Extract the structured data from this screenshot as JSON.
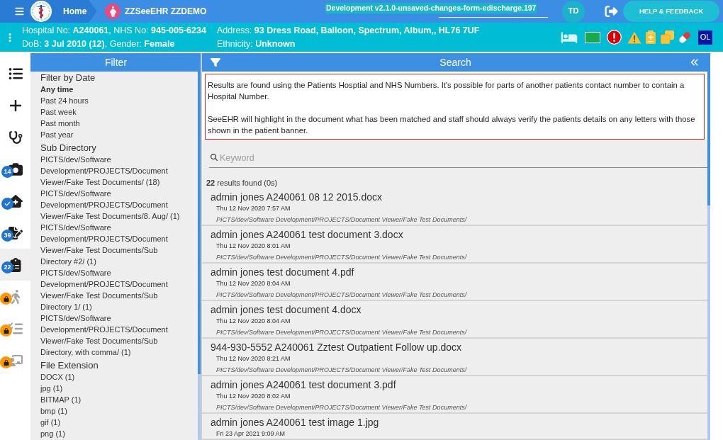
{
  "top_bar": {
    "breadcrumb": "Home",
    "patient_name": "ZZSeeEHR ZZDEMO",
    "version": "Development v2.1.0-unsaved-changes-form-edischarge.197",
    "user_initials": "TD",
    "help_button": "HELP & FEEDBACK"
  },
  "patient_banner": {
    "hospital_line": "Hospital No: **A240061**, NHS No: **945-005-6234**",
    "dob_line": "DoB: **3 Jul 2010 (12)**, Gender: **Female**",
    "address_line": "Address: **93 Dress Road, Balloon, Spectrum, Album,, HL76 7UF**",
    "ethnicity_line": "Ethnicity: **Unknown**",
    "flag_label": "OL"
  },
  "nav": [
    {
      "kind": "list",
      "selected": false,
      "locked": false,
      "verified": false
    },
    {
      "kind": "add",
      "selected": false,
      "locked": false,
      "verified": false
    },
    {
      "kind": "stethoscope",
      "selected": false,
      "locked": false,
      "verified": false
    },
    {
      "kind": "camera",
      "badge": "14",
      "selected": false,
      "locked": false,
      "verified": false
    },
    {
      "kind": "house",
      "selected": false,
      "locked": false,
      "verified": true
    },
    {
      "kind": "signature",
      "badge": "39",
      "selected": false,
      "locked": false,
      "verified": false
    },
    {
      "kind": "clipboard",
      "badge": "22",
      "selected": true,
      "locked": false,
      "verified": false
    },
    {
      "kind": "walker",
      "selected": false,
      "locked": true,
      "verified": false
    },
    {
      "kind": "checklist",
      "selected": false,
      "locked": true,
      "verified": false
    },
    {
      "kind": "presentation",
      "selected": false,
      "locked": true,
      "verified": false
    }
  ],
  "filter": {
    "title": "Filter",
    "sections": [
      {
        "heading": "Filter by Date",
        "options": [
          {
            "label": "Any time",
            "selected": true
          },
          {
            "label": "Past 24 hours",
            "selected": false
          },
          {
            "label": "Past week",
            "selected": false
          },
          {
            "label": "Past month",
            "selected": false
          },
          {
            "label": "Past year",
            "selected": false
          }
        ]
      },
      {
        "heading": "Sub Directory",
        "options": [
          {
            "label": "PICTS/dev/Software Development/PROJECTS/Document Viewer/Fake Test Documents/ (18)"
          },
          {
            "label": "PICTS/dev/Software Development/PROJECTS/Document Viewer/Fake Test Documents/8. Aug/ (1)"
          },
          {
            "label": "PICTS/dev/Software Development/PROJECTS/Document Viewer/Fake Test Documents/Sub Directory #2/ (1)"
          },
          {
            "label": "PICTS/dev/Software Development/PROJECTS/Document Viewer/Fake Test Documents/Sub Directory 1/ (1)"
          },
          {
            "label": "PICTS/dev/Software Development/PROJECTS/Document Viewer/Fake Test Documents/Sub Directory, with comma/ (1)"
          }
        ]
      },
      {
        "heading": "File Extension",
        "options": [
          {
            "label": "DOCX (1)"
          },
          {
            "label": "jpg (1)"
          },
          {
            "label": "BITMAP (1)"
          },
          {
            "label": "bmp (1)"
          },
          {
            "label": "gif (1)"
          },
          {
            "label": "png (1)"
          }
        ]
      }
    ]
  },
  "search": {
    "title": "Search",
    "notice": [
      "Results are found using the Patients Hosptial and NHS Numbers. It's possible for parts of another patients contact number to contain a Hospital Number.",
      "SeeEHR will highlight in the document what has been matched and staff should always verify the patients details on any letters with those shown in the patient banner."
    ],
    "keyword_field": {
      "placeholder": "Keyword"
    },
    "result_count": "**22** results found (0s)",
    "results": [
      {
        "title": "admin jones A240061 08 12 2015.docx",
        "date": "Thu 12 Nov 2020 7:57 AM",
        "path": "PICTS/dev/Software Development/PROJECTS/Document Viewer/Fake Test Documents/"
      },
      {
        "title": "admin jones A240061 test document 3.docx",
        "date": "Thu 12 Nov 2020 8:01 AM",
        "path": "PICTS/dev/Software Development/PROJECTS/Document Viewer/Fake Test Documents/"
      },
      {
        "title": "admin jones test document 4.pdf",
        "date": "Thu 12 Nov 2020 8:04 AM",
        "path": "PICTS/dev/Software Development/PROJECTS/Document Viewer/Fake Test Documents/"
      },
      {
        "title": "admin jones test document 4.docx",
        "date": "Thu 12 Nov 2020 8:04 AM",
        "path": "PICTS/dev/Software Development/PROJECTS/Document Viewer/Fake Test Documents/"
      },
      {
        "title": "944-930-5552 A240061 Zztest Outpatient Follow up.docx",
        "date": "Thu 12 Nov 2020 8:21 AM",
        "path": "PICTS/dev/Software Development/PROJECTS/Document Viewer/Fake Test Documents/"
      },
      {
        "title": "admin jones A240061 test document 3.pdf",
        "date": "Thu 12 Nov 2020 8:02 AM",
        "path": "PICTS/dev/Software Development/PROJECTS/Document Viewer/Fake Test Documents/"
      },
      {
        "title": "admin jones A240061 test image 1.jpg",
        "date": "Fri 23 Apr 2021 9:09 AM"
      }
    ]
  }
}
